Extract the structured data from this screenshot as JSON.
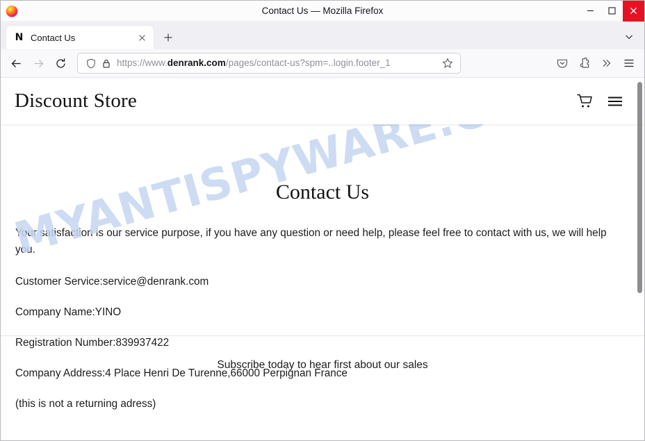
{
  "window": {
    "title": "Contact Us — Mozilla Firefox",
    "app_icon": "firefox-logo-icon",
    "controls": {
      "minimize": "minimize-icon",
      "maximize": "maximize-icon",
      "close": "close-icon",
      "close_bg": "#e81123"
    }
  },
  "tabs": {
    "items": [
      {
        "title": "Contact Us",
        "favicon_glyph": "N",
        "favicon_name": "site-favicon-n",
        "active": true
      }
    ],
    "new_tab_label": "+",
    "tab_list_menu": "chevron-down-icon"
  },
  "toolbar": {
    "back": "back-arrow-icon",
    "forward": "forward-arrow-icon",
    "reload": "reload-icon",
    "shield": "shield-icon",
    "lock": "padlock-icon",
    "url_prefix": "https://www.",
    "url_host": "denrank.com",
    "url_path": "/pages/contact-us?spm=..login.footer_1",
    "bookmark": "star-icon",
    "pocket": "pocket-save-icon",
    "extensions": "puzzle-piece-icon",
    "overflow": "double-chevron-right-icon",
    "app_menu": "hamburger-menu-icon"
  },
  "site": {
    "brand": "Discount Store",
    "cart_icon": "shopping-cart-icon",
    "menu_icon": "hamburger-menu-icon"
  },
  "page": {
    "heading": "Contact Us",
    "paragraphs": [
      "Your satisfaction is our service purpose, if you have any question or need help, please feel free to contact with us, we will help you.",
      "Customer Service:service@denrank.com",
      "Company Name:YINO",
      "Registration Number:839937422",
      "Company Address:4 Place Henri De Turenne,66000 Perpignan France",
      "(this is not a returning adress)"
    ],
    "watermark": "MYANTISPYWARE.COM",
    "watermark_color": "#c5d6f2"
  },
  "footer": {
    "subscribe_text": "Subscribe today to hear first about our sales"
  }
}
